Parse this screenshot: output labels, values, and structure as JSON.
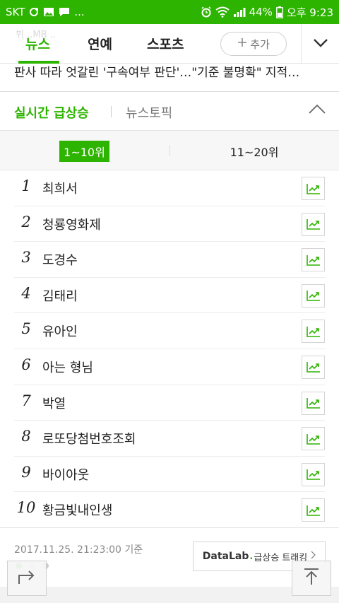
{
  "status_bar": {
    "carrier": "SKT",
    "dots": "...",
    "battery": "44%",
    "time": "오후 9:23"
  },
  "tabs": {
    "ghost_text": "뷔 ..MB ..",
    "items": [
      {
        "label": "뉴스",
        "active": true
      },
      {
        "label": "연예",
        "active": false
      },
      {
        "label": "스포츠",
        "active": false
      }
    ],
    "add_label": "추가"
  },
  "headline": "판사 따라 엇갈린 '구속여부 판단'…\"기준 불명확\" 지적…",
  "section": {
    "title": "실시간 급상승",
    "topic": "뉴스토픽"
  },
  "range": {
    "first": "1~10위",
    "second": "11~20위"
  },
  "ranking": [
    {
      "rank": "1",
      "keyword": "최희서"
    },
    {
      "rank": "2",
      "keyword": "청룡영화제"
    },
    {
      "rank": "3",
      "keyword": "도경수"
    },
    {
      "rank": "4",
      "keyword": "김태리"
    },
    {
      "rank": "5",
      "keyword": "유아인"
    },
    {
      "rank": "6",
      "keyword": "아는 형님"
    },
    {
      "rank": "7",
      "keyword": "박열"
    },
    {
      "rank": "8",
      "keyword": "로또당첨번호조회"
    },
    {
      "rank": "9",
      "keyword": "바이아웃"
    },
    {
      "rank": "10",
      "keyword": "황금빛내인생"
    }
  ],
  "footer": {
    "timestamp": "2017.11.25. 21:23:00 기준",
    "datalab_brand": "DataLab",
    "datalab_dot": ".",
    "datalab_text": "급상승 트래킹"
  },
  "colors": {
    "accent": "#2db400"
  }
}
